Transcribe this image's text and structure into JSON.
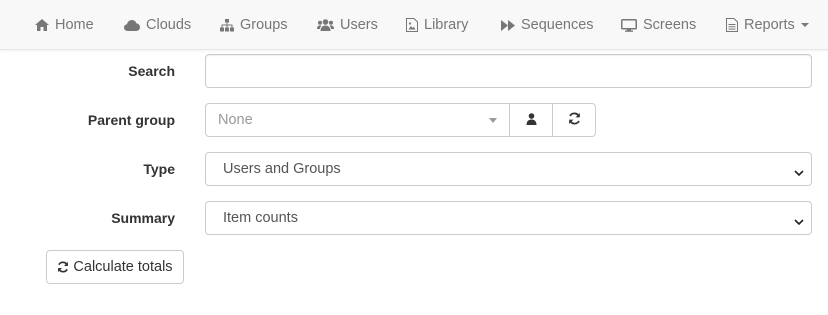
{
  "nav": {
    "items": [
      {
        "label": "Home",
        "icon": "home-icon"
      },
      {
        "label": "Clouds",
        "icon": "cloud-icon"
      },
      {
        "label": "Groups",
        "icon": "sitemap-icon"
      },
      {
        "label": "Users",
        "icon": "users-icon"
      },
      {
        "label": "Library",
        "icon": "image-file-icon"
      },
      {
        "label": "Sequences",
        "icon": "fast-forward-icon"
      },
      {
        "label": "Screens",
        "icon": "desktop-icon"
      },
      {
        "label": "Reports",
        "icon": "document-icon"
      }
    ]
  },
  "form": {
    "search": {
      "label": "Search",
      "value": "",
      "placeholder": ""
    },
    "parent_group": {
      "label": "Parent group",
      "value": "None"
    },
    "type": {
      "label": "Type",
      "value": "Users and Groups"
    },
    "summary": {
      "label": "Summary",
      "value": "Item counts"
    }
  },
  "actions": {
    "calculate_label": "Calculate totals"
  },
  "colors": {
    "nav_bg": "#f8f8f8",
    "nav_text": "#777777",
    "border": "#cccccc"
  }
}
